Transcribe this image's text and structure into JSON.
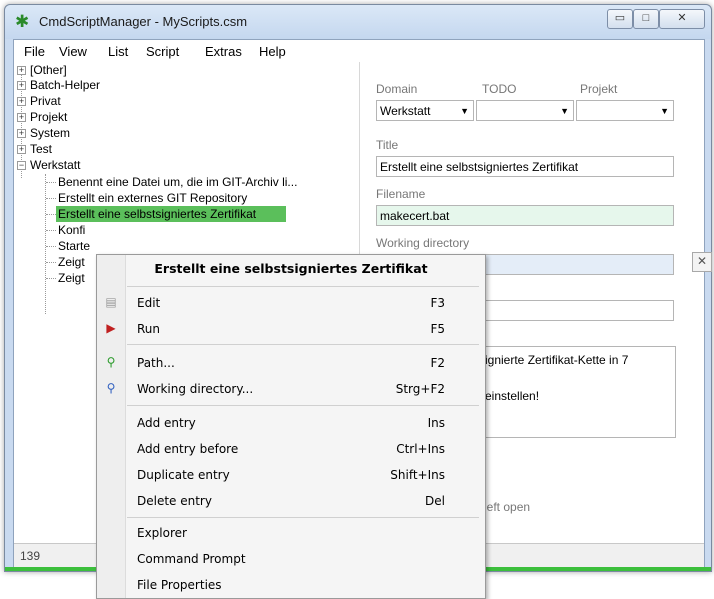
{
  "window": {
    "title": "CmdScriptManager - MyScripts.csm",
    "min_glyph": "▭",
    "max_glyph": "□",
    "close_glyph": "✕"
  },
  "menu": [
    "File",
    "View",
    "List",
    "Script",
    "Extras",
    "Help"
  ],
  "tree": {
    "groups": [
      "[Other]",
      "Batch-Helper",
      "Privat",
      "Projekt",
      "System",
      "Test",
      "Werkstatt"
    ],
    "children": [
      "Benennt eine Datei um, die im GIT-Archiv li...",
      "Erstellt ein externes GIT Repository",
      "Erstellt eine selbstsigniertes Zertifikat",
      "Konfi",
      "Starte",
      "Zeigt",
      "Zeigt"
    ]
  },
  "fields": {
    "domain_label": "Domain",
    "todo_label": "TODO",
    "projekt_label": "Projekt",
    "domain_value": "Werkstatt",
    "todo_value": "",
    "projekt_value": "",
    "title_label": "Title",
    "title_value": "Erstellt eine selbstsigniertes Zertifikat",
    "filename_label": "Filename",
    "filename_value": "makecert.bat",
    "workdir_label": "Working directory",
    "workdir_value": "",
    "description_line1": "ignierte Zertifikat-Kette in 7",
    "description_line2": "einstellen!",
    "left_open_text": "left open"
  },
  "status": {
    "count": "139"
  },
  "context_menu": {
    "header": "Erstellt eine selbstsigniertes Zertifikat",
    "items": [
      {
        "label": "Edit",
        "key": "F3",
        "icon": "document-icon"
      },
      {
        "label": "Run",
        "key": "F5",
        "icon": "run-icon"
      },
      {
        "label": "Path...",
        "key": "F2",
        "icon": "search-icon"
      },
      {
        "label": "Working directory...",
        "key": "Strg+F2",
        "icon": "search-folder-icon"
      },
      {
        "label": "Add entry",
        "key": "Ins",
        "icon": ""
      },
      {
        "label": "Add entry before",
        "key": "Ctrl+Ins",
        "icon": ""
      },
      {
        "label": "Duplicate entry",
        "key": "Shift+Ins",
        "icon": ""
      },
      {
        "label": "Delete entry",
        "key": "Del",
        "icon": ""
      },
      {
        "label": "Explorer",
        "key": "",
        "icon": ""
      },
      {
        "label": "Command Prompt",
        "key": "",
        "icon": ""
      },
      {
        "label": "File Properties",
        "key": "",
        "icon": ""
      }
    ]
  },
  "colors": {
    "selection": "#5bbf5b",
    "progress": "#3cbf3c"
  }
}
